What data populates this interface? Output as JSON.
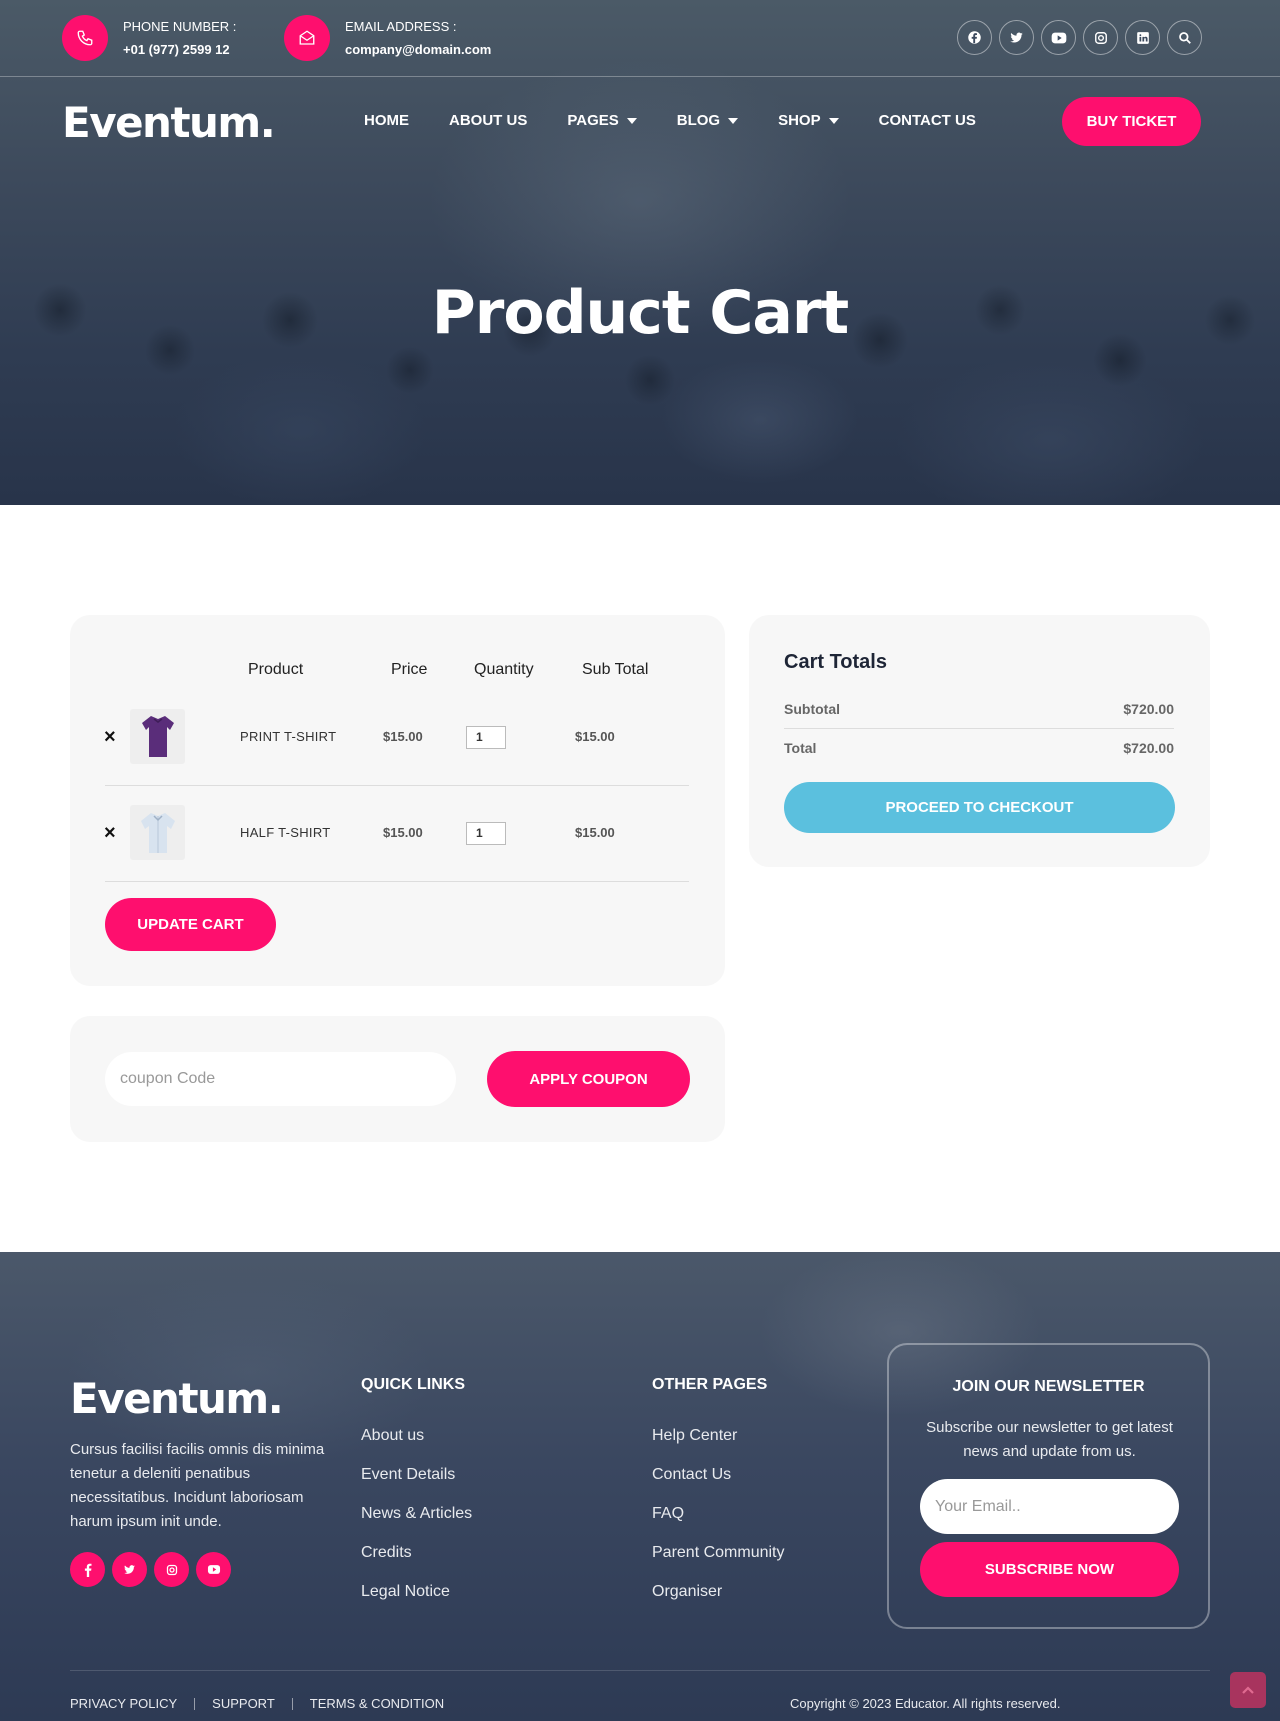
{
  "topbar": {
    "phone_label": "PHONE NUMBER :",
    "phone_value": "+01 (977) 2599 12",
    "email_label": "EMAIL ADDRESS :",
    "email_value": "company@domain.com",
    "social_icons": [
      "facebook-icon",
      "twitter-icon",
      "youtube-icon",
      "instagram-icon",
      "linkedin-icon",
      "search-icon"
    ]
  },
  "nav": {
    "logo": "Eventum.",
    "items": [
      {
        "label": "HOME"
      },
      {
        "label": "ABOUT US"
      },
      {
        "label": "PAGES"
      },
      {
        "label": "BLOG"
      },
      {
        "label": "SHOP"
      },
      {
        "label": "CONTACT US"
      }
    ],
    "cta": "BUY TICKET"
  },
  "hero": {
    "title": "Product Cart"
  },
  "cart": {
    "headers": {
      "product": "Product",
      "price": "Price",
      "quantity": "Quantity",
      "subtotal": "Sub Total"
    },
    "rows": [
      {
        "name": "PRINT T-SHIRT",
        "price": "$15.00",
        "qty": "1",
        "subtotal": "$15.00",
        "remove": "×"
      },
      {
        "name": "HALF T-SHIRT",
        "price": "$15.00",
        "qty": "1",
        "subtotal": "$15.00",
        "remove": "×"
      }
    ],
    "update_label": "UPDATE CART"
  },
  "coupon": {
    "placeholder": "coupon Code",
    "apply_label": "APPLY COUPON"
  },
  "totals": {
    "title": "Cart Totals",
    "subtotal_label": "Subtotal",
    "subtotal_value": "$720.00",
    "total_label": "Total",
    "total_value": "$720.00",
    "checkout_label": "PROCEED TO CHECKOUT"
  },
  "footer": {
    "logo": "Eventum.",
    "description": "Cursus facilisi facilis omnis dis minima tenetur a deleniti penatibus necessitatibus. Incidunt laboriosam harum ipsum init unde.",
    "quick_links": {
      "title": "QUICK LINKS",
      "items": [
        "About us",
        "Event Details",
        "News & Articles",
        "Credits",
        "Legal Notice"
      ]
    },
    "other_pages": {
      "title": "OTHER PAGES",
      "items": [
        "Help Center",
        "Contact Us",
        "FAQ",
        "Parent Community",
        "Organiser"
      ]
    },
    "newsletter": {
      "title": "JOIN OUR NEWSLETTER",
      "description": "Subscribe our newsletter to get latest news and update from us.",
      "placeholder": "Your Email..",
      "button": "SUBSCRIBE NOW"
    },
    "bottom_links": [
      "PRIVACY POLICY",
      "SUPPORT",
      "TERMS & CONDITION"
    ],
    "copyright": "Copyright © 2023 Educator. All rights reserved."
  },
  "colors": {
    "accent": "#fe0f6e",
    "checkout": "#5bc0de",
    "panel": "#f7f7f7"
  }
}
